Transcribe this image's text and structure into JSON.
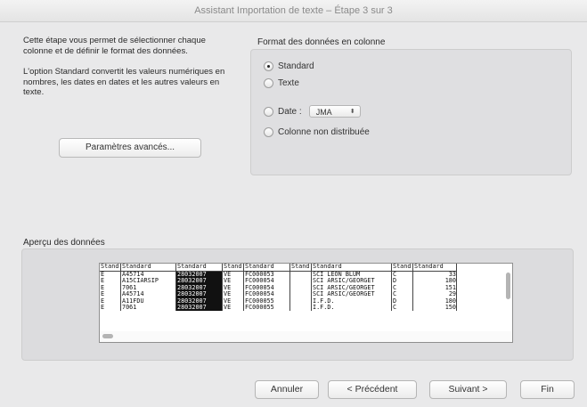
{
  "window": {
    "title": "Assistant Importation de texte – Étape 3 sur 3"
  },
  "description": {
    "paragraph1": "Cette étape vous permet de sélectionner chaque colonne et de définir le format des données.",
    "paragraph2": "L'option Standard convertit les valeurs numériques en nombres, les dates en dates et les autres valeurs en texte."
  },
  "advanced_button": "Paramètres avancés...",
  "format": {
    "label": "Format des données en colonne",
    "options": {
      "standard": "Standard",
      "texte": "Texte",
      "date": "Date :",
      "skip": "Colonne non distribuée"
    },
    "selected": "standard",
    "date_value": "JMA"
  },
  "preview": {
    "label": "Aperçu des données",
    "columns": [
      {
        "header": "Stand",
        "cells": [
          "E",
          "E",
          "E",
          "E",
          "E",
          "E"
        ]
      },
      {
        "header": "Standard",
        "cells": [
          "A45714",
          "A15CIARSIP",
          "7061",
          "A45714",
          "A11FDU",
          "7061"
        ]
      },
      {
        "header": "Standard",
        "cells": [
          "28032007",
          "28032007",
          "28032007",
          "28032007",
          "28032007",
          "28032007"
        ]
      },
      {
        "header": "Stand",
        "cells": [
          "VE",
          "VE",
          "VE",
          "VE",
          "VE",
          "VE"
        ]
      },
      {
        "header": "Standard",
        "cells": [
          "FC000053",
          "FC000054",
          "FC000054",
          "FC000054",
          "FC000055",
          "FC000055"
        ]
      },
      {
        "header": "Stand",
        "cells": [
          "",
          "",
          "",
          "",
          "",
          ""
        ]
      },
      {
        "header": "Standard",
        "cells": [
          "SCI LEON BLUM",
          "SCI ARSIC/GEORGET",
          "SCI ARSIC/GEORGET",
          "SCI ARSIC/GEORGET",
          "I.F.D.",
          "I.F.D."
        ]
      },
      {
        "header": "Stand",
        "cells": [
          "C",
          "D",
          "C",
          "C",
          "D",
          "C"
        ]
      },
      {
        "header": "Standard",
        "cells": [
          "33",
          "180",
          "151",
          "29",
          "180",
          "150"
        ]
      }
    ],
    "selected_column": 2
  },
  "buttons": {
    "cancel": "Annuler",
    "previous": "< Précédent",
    "next": "Suivant >",
    "finish": "Fin"
  }
}
